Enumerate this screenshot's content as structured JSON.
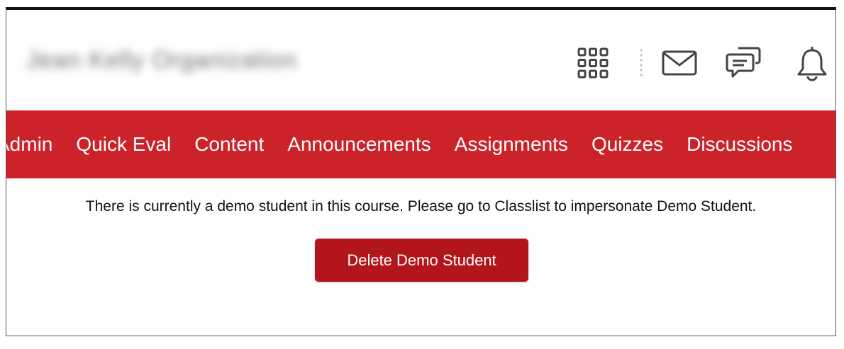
{
  "header": {
    "org_name": "Jean Kelly Organization",
    "icons": {
      "course_selector": "waffle-grid-icon",
      "messages": "envelope-icon",
      "subscriptions": "chat-bubbles-icon",
      "notifications": "bell-icon"
    }
  },
  "navbar": {
    "items": [
      {
        "label": "Admin"
      },
      {
        "label": "Quick Eval"
      },
      {
        "label": "Content"
      },
      {
        "label": "Announcements"
      },
      {
        "label": "Assignments"
      },
      {
        "label": "Quizzes"
      },
      {
        "label": "Discussions"
      }
    ]
  },
  "main": {
    "message": "There is currently a demo student in this course. Please go to Classlist to impersonate Demo Student.",
    "delete_button_label": "Delete Demo Student"
  },
  "colors": {
    "nav_background": "#cc2229",
    "button_background": "#b3151c",
    "icon_stroke": "#444444"
  }
}
